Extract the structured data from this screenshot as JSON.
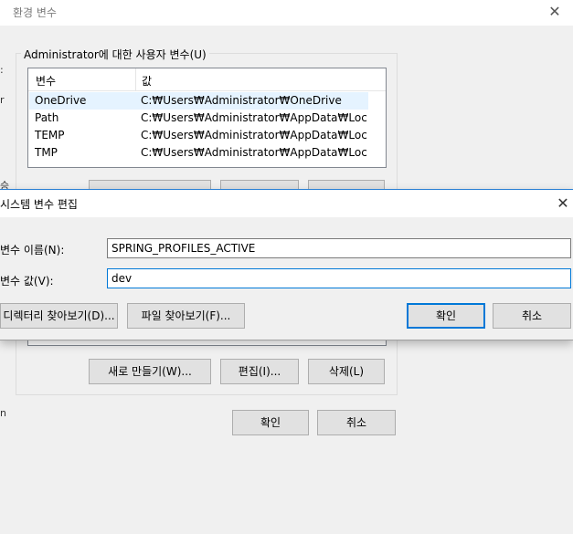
{
  "env_dialog": {
    "title": "환경 변수",
    "close_icon": "close-icon",
    "user_group_label": "Administrator에 대한 사용자 변수(U)",
    "columns": [
      "변수",
      "값"
    ],
    "user_vars": [
      {
        "name": "OneDrive",
        "value": "C:₩Users₩Administrator₩OneDrive"
      },
      {
        "name": "Path",
        "value": "C:₩Users₩Administrator₩AppData₩Local₩..."
      },
      {
        "name": "TEMP",
        "value": "C:₩Users₩Administrator₩AppData₩Local₩..."
      },
      {
        "name": "TMP",
        "value": "C:₩Users₩Administrator₩AppData₩Local₩..."
      }
    ],
    "system_buttons": {
      "new": "새로 만들기(W)...",
      "edit": "편집(I)...",
      "delete": "삭제(L)"
    },
    "ok": "확인",
    "cancel": "취소"
  },
  "edit_dialog": {
    "title": "시스템 변수 편집",
    "close_icon": "close-icon",
    "name_label": "변수 이름(N):",
    "name_value": "SPRING_PROFILES_ACTIVE",
    "value_label": "변수 값(V):",
    "value_value": "dev",
    "browse_dir": "디렉터리 찾아보기(D)...",
    "browse_file": "파일 찾아보기(F)...",
    "ok": "확인",
    "cancel": "취소"
  },
  "colors": {
    "selected_row": "#e5f3ff",
    "focus_border": "#0078d7",
    "dialog_bg": "#f0f0f0"
  }
}
